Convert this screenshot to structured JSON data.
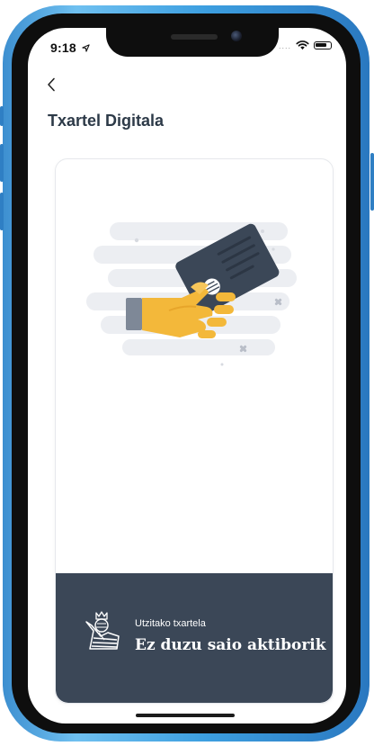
{
  "status_bar": {
    "time": "9:18",
    "signal": "....",
    "icons": [
      "location-arrow-icon",
      "wifi-icon",
      "battery-icon"
    ]
  },
  "nav": {
    "back_icon": "chevron-left-icon"
  },
  "page": {
    "title": "Txartel Digitala"
  },
  "card": {
    "illustration_icon": "hand-holding-card-icon",
    "crest_icon": "club-crest-icon",
    "caption": "Utzitako txartela",
    "status_text": "Ez duzu saio aktiborik"
  },
  "colors": {
    "title": "#2d3a48",
    "card_footer": "#3b4757",
    "hand": "#f3b83a",
    "card_body": "#3b4757",
    "phone_frame": "#4aa6e6"
  }
}
